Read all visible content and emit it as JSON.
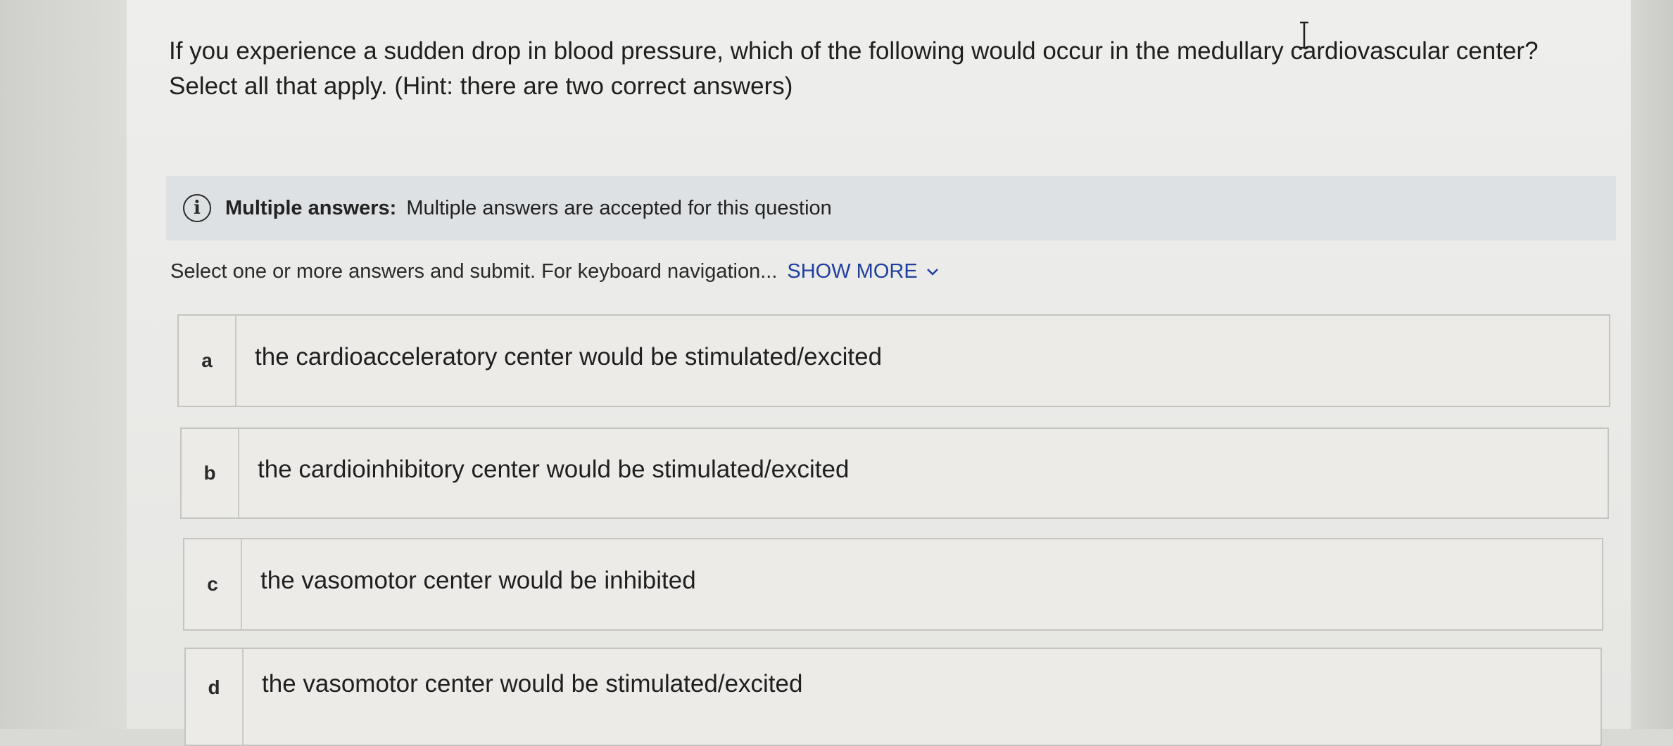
{
  "question": {
    "line1": "If you experience a sudden drop in blood pressure, which of the following would occur in the medullary cardiovascular center?",
    "line2": "Select all that apply. (Hint: there are two correct answers)"
  },
  "banner": {
    "icon": "info-icon",
    "title": "Multiple answers:",
    "text": "Multiple answers are accepted for this question"
  },
  "instructions": {
    "text": "Select one or more answers and submit. For keyboard navigation...",
    "show_more_label": "SHOW MORE"
  },
  "options": [
    {
      "letter": "a",
      "text": "the cardioacceleratory center would be stimulated/excited"
    },
    {
      "letter": "b",
      "text": "the cardioinhibitory center would be stimulated/excited"
    },
    {
      "letter": "c",
      "text": "the vasomotor center would be inhibited"
    },
    {
      "letter": "d",
      "text": "the vasomotor center would be stimulated/excited"
    }
  ],
  "colors": {
    "link": "#1f3f9e",
    "banner_bg": "#dde1e3",
    "page_bg": "#ececea"
  }
}
